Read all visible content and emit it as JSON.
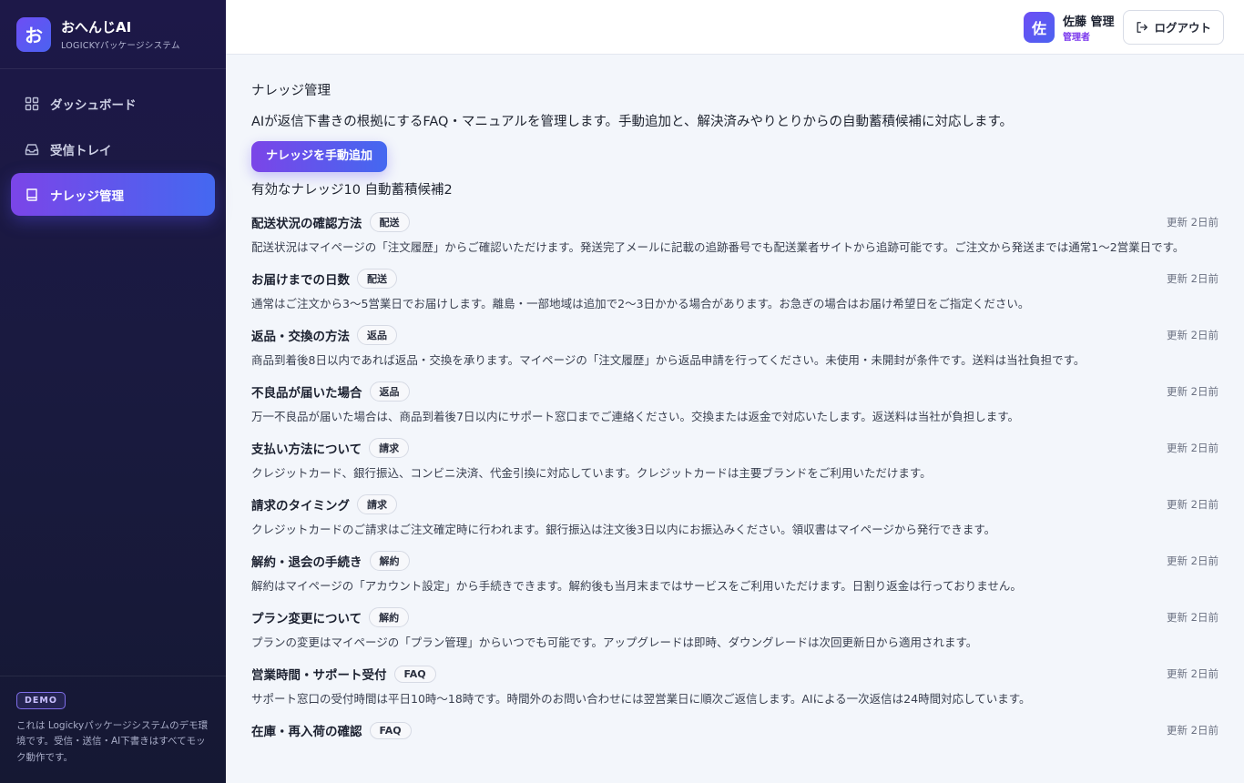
{
  "brand": {
    "logo": "お",
    "title": "おへんじAI",
    "subtitle": "LOGICKYパッケージシステム"
  },
  "nav": [
    {
      "label": "ダッシュボード",
      "icon": "grid-icon"
    },
    {
      "label": "受信トレイ",
      "icon": "inbox-icon"
    },
    {
      "label": "ナレッジ管理",
      "icon": "book-icon",
      "active": true
    }
  ],
  "footer": {
    "badge": "DEMO",
    "note": "これは Logickyパッケージシステムのデモ環境です。受信・送信・AI下書きはすべてモック動作です。"
  },
  "user": {
    "avatar": "佐",
    "name": "佐藤 管理",
    "role": "管理者"
  },
  "logout_label": "ログアウト",
  "page": {
    "title": "ナレッジ管理",
    "description": "AIが返信下書きの根拠にするFAQ・マニュアルを管理します。手動追加と、解決済みやりとりからの自動蓄積候補に対応します。",
    "add_button": "ナレッジを手動追加",
    "stats": "有効なナレッジ10 自動蓄積候補2"
  },
  "items": [
    {
      "title": "配送状況の確認方法",
      "tag": "配送",
      "updated": "更新 2日前",
      "body": "配送状況はマイページの「注文履歴」からご確認いただけます。発送完了メールに記載の追跡番号でも配送業者サイトから追跡可能です。ご注文から発送までは通常1〜2営業日です。"
    },
    {
      "title": "お届けまでの日数",
      "tag": "配送",
      "updated": "更新 2日前",
      "body": "通常はご注文から3〜5営業日でお届けします。離島・一部地域は追加で2〜3日かかる場合があります。お急ぎの場合はお届け希望日をご指定ください。"
    },
    {
      "title": "返品・交換の方法",
      "tag": "返品",
      "updated": "更新 2日前",
      "body": "商品到着後8日以内であれば返品・交換を承ります。マイページの「注文履歴」から返品申請を行ってください。未使用・未開封が条件です。送料は当社負担です。"
    },
    {
      "title": "不良品が届いた場合",
      "tag": "返品",
      "updated": "更新 2日前",
      "body": "万一不良品が届いた場合は、商品到着後7日以内にサポート窓口までご連絡ください。交換または返金で対応いたします。返送料は当社が負担します。"
    },
    {
      "title": "支払い方法について",
      "tag": "請求",
      "updated": "更新 2日前",
      "body": "クレジットカード、銀行振込、コンビニ決済、代金引換に対応しています。クレジットカードは主要ブランドをご利用いただけます。"
    },
    {
      "title": "請求のタイミング",
      "tag": "請求",
      "updated": "更新 2日前",
      "body": "クレジットカードのご請求はご注文確定時に行われます。銀行振込は注文後3日以内にお振込みください。領収書はマイページから発行できます。"
    },
    {
      "title": "解約・退会の手続き",
      "tag": "解約",
      "updated": "更新 2日前",
      "body": "解約はマイページの「アカウント設定」から手続きできます。解約後も当月末まではサービスをご利用いただけます。日割り返金は行っておりません。"
    },
    {
      "title": "プラン変更について",
      "tag": "解約",
      "updated": "更新 2日前",
      "body": "プランの変更はマイページの「プラン管理」からいつでも可能です。アップグレードは即時、ダウングレードは次回更新日から適用されます。"
    },
    {
      "title": "営業時間・サポート受付",
      "tag": "FAQ",
      "updated": "更新 2日前",
      "body": "サポート窓口の受付時間は平日10時〜18時です。時間外のお問い合わせには翌営業日に順次ご返信します。AIによる一次返信は24時間対応しています。"
    },
    {
      "title": "在庫・再入荷の確認",
      "tag": "FAQ",
      "updated": "更新 2日前",
      "body": ""
    }
  ]
}
